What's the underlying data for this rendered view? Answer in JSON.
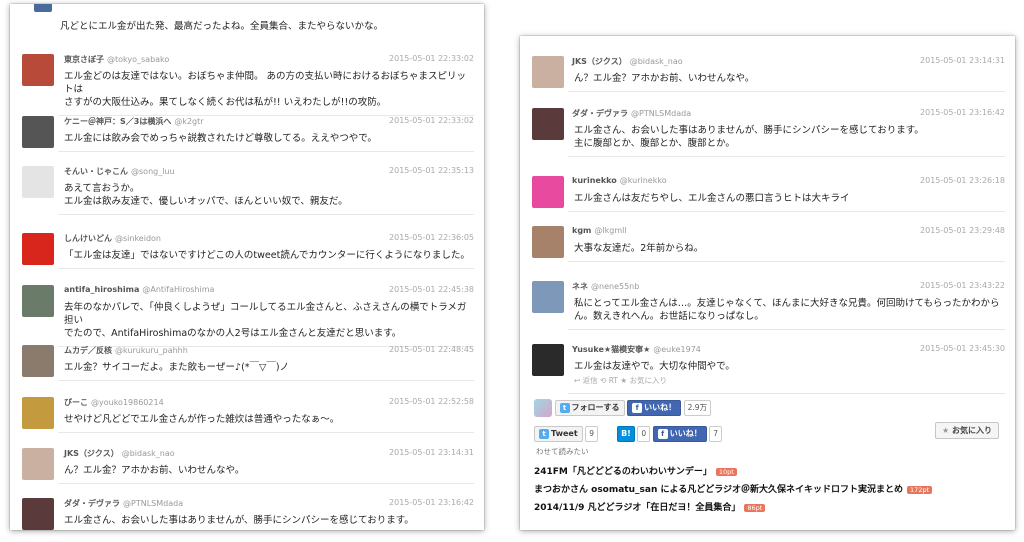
{
  "left_panel": {
    "top_fragment": "凡どとにエル金が出た発、最高だったよね。全員集合、またやらないかな。",
    "tweets": [
      {
        "name": "東京さぼ子",
        "handle": "@tokyo_sabako",
        "time": "2015-05-01 22:33:02",
        "lines": [
          "エル金どのは友達ではない。おぼちゃま仲間。 あの方の支払い時におけるおぼちゃまスピリットは",
          "さすがの大阪仕込み。果てしなく続くお代は私が!! いえわたしが!!の攻防。"
        ]
      },
      {
        "name": "ケニー＠神戸：S／3は横浜へ",
        "handle": "@k2gtr",
        "time": "2015-05-01 22:33:02",
        "lines": [
          "エル金には飲み会でめっちゃ説教されたけど尊敬してる。ええやつやで。"
        ]
      },
      {
        "name": "そんい・じゃこん",
        "handle": "@song_luu",
        "time": "2015-05-01 22:35:13",
        "lines": [
          "あえて言おうか。",
          "エル金は飲み友達で、優しいオッパで、ほんといい奴で、親友だ。"
        ]
      },
      {
        "name": "しんけいどん",
        "handle": "@sinkeidon",
        "time": "2015-05-01 22:36:05",
        "lines": [
          "「エル金は友達」ではないですけどこの人のtweet読んでカウンターに行くようになりました。"
        ]
      },
      {
        "name": "antifa_hiroshima",
        "handle": "@AntifaHiroshima",
        "time": "2015-05-01 22:45:38",
        "lines": [
          "去年のなかパレで、「仲良くしようぜ」コールしてるエル金さんと、ふさえさんの横でトラメガ担い",
          "でたので、AntifaHiroshimaのなかの人2号はエル金さんと友達だと思います。"
        ]
      },
      {
        "name": "ムカデ／反核",
        "handle": "@kurukuru_pahhh",
        "time": "2015-05-01 22:48:45",
        "lines": [
          "エル金？サイコーだよ。また飲もーぜー♪(*￣▽￣)ノ"
        ]
      },
      {
        "name": "びーこ",
        "handle": "@youko19860214",
        "time": "2015-05-01 22:52:58",
        "lines": [
          "せやけど凡どどでエル金さんが作った雑炊は普通やったなぁ〜。"
        ]
      },
      {
        "name": "JKS（ジクス）",
        "handle": "@bidask_nao",
        "time": "2015-05-01 23:14:31",
        "lines": [
          "ん？エル金？アホかお前、いわせんなや。"
        ]
      },
      {
        "name": "ダダ・デヴァラ",
        "handle": "@PTNLSMdada",
        "time": "2015-05-01 23:16:42",
        "lines": [
          "エル金さん、お会いした事はありませんが、勝手にシンパシーを感じております。"
        ]
      }
    ]
  },
  "right_panel": {
    "tweets": [
      {
        "name": "JKS（ジクス）",
        "handle": "@bidask_nao",
        "time": "2015-05-01 23:14:31",
        "lines": [
          "ん？エル金？アホかお前、いわせんなや。"
        ]
      },
      {
        "name": "ダダ・デヴァラ",
        "handle": "@PTNLSMdada",
        "time": "2015-05-01 23:16:42",
        "lines": [
          "エル金さん、お会いした事はありませんが、勝手にシンパシーを感じております。",
          "主に腹部とか、腹部とか、腹部とか。"
        ]
      },
      {
        "name": "kurinekko",
        "handle": "@kurinekko",
        "time": "2015-05-01 23:26:18",
        "lines": [
          "エル金さんは友だちやし、エル金さんの悪口言うヒトは大キライ"
        ]
      },
      {
        "name": "kgm",
        "handle": "@lkgmll",
        "time": "2015-05-01 23:29:48",
        "lines": [
          "大事な友達だ。2年前からね。"
        ]
      },
      {
        "name": "ネネ",
        "handle": "@nene55nb",
        "time": "2015-05-01 23:43:22",
        "lines": [
          "私にとってエル金さんは…。友達じゃなくて、ほんまに大好きな兄貴。何回助けてもらったかわから",
          "ん。数えきれへん。お世話になりっぱなし。"
        ]
      },
      {
        "name": "Yusuke★猫模安寧★",
        "handle": "@euke1974",
        "time": "2015-05-01 23:45:30",
        "lines": [
          "エル金は友達やで。大切な仲間やで。"
        ],
        "actions": "↩ 返信  ⟲ RT  ★ お気に入り"
      }
    ],
    "follow_label": "フォローする",
    "like_label": "いいね！",
    "like_count": "2.9万",
    "tweet_label": "Tweet",
    "tweet_count": "9",
    "hatena_label": "B!",
    "hatena_count": "0",
    "like2_label": "いいね！",
    "like2_count": "7",
    "fav_label": "お気に入り",
    "related_title": "わせて読みたい",
    "related": [
      {
        "text": "241FM「凡どどどるのわいわいサンデー」",
        "badge": "10pt"
      },
      {
        "text": "まつおかさん osomatu_san による凡どどラジオ＠新大久保ネイキッドロフト実況まとめ",
        "badge": "172pt"
      },
      {
        "text": "2014/11/9 凡どどラジオ「在日だヨ！全員集合」",
        "badge": "86pt"
      }
    ]
  },
  "colors": {
    "accent_blue": "#3b5998",
    "badge": "#e8765c",
    "twitter_blue": "#55acee"
  }
}
